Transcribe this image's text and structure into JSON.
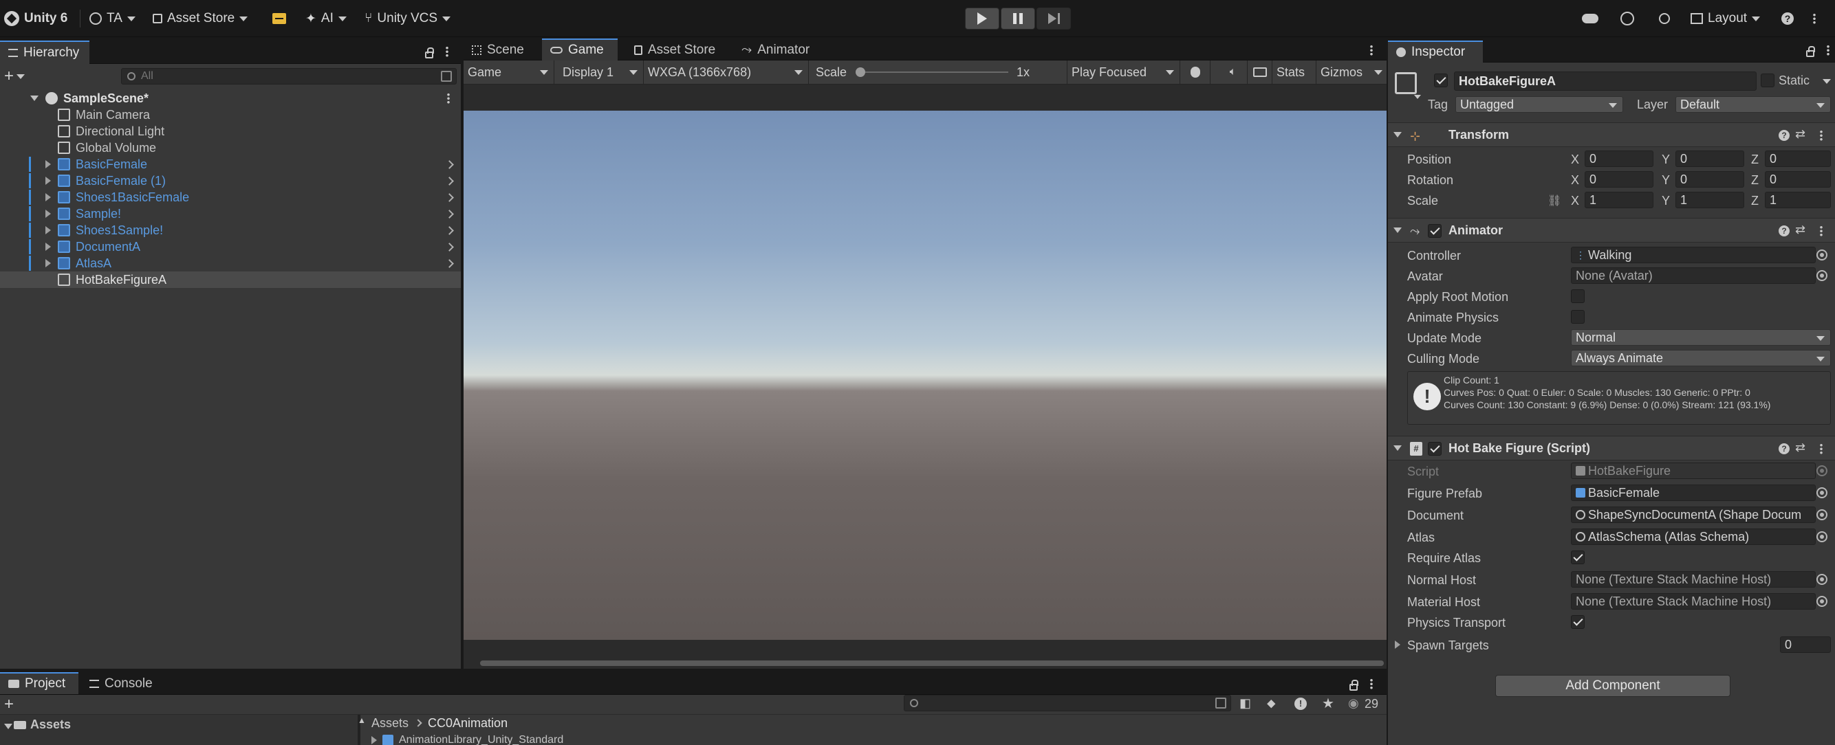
{
  "topbar": {
    "app_name": "Unity 6",
    "account": "TA",
    "asset_store": "Asset Store",
    "ai": "AI",
    "vcs": "Unity VCS",
    "layout": "Layout"
  },
  "hierarchy": {
    "tab": "Hierarchy",
    "search_placeholder": "All",
    "scene": "SampleScene*",
    "items": [
      {
        "label": "Main Camera",
        "prefab": false
      },
      {
        "label": "Directional Light",
        "prefab": false
      },
      {
        "label": "Global Volume",
        "prefab": false
      },
      {
        "label": "BasicFemale",
        "prefab": true
      },
      {
        "label": "BasicFemale (1)",
        "prefab": true
      },
      {
        "label": "Shoes1BasicFemale",
        "prefab": true
      },
      {
        "label": "Sample!",
        "prefab": true
      },
      {
        "label": "Shoes1Sample!",
        "prefab": true
      },
      {
        "label": "DocumentA",
        "prefab": true
      },
      {
        "label": "AtlasA",
        "prefab": true
      },
      {
        "label": "HotBakeFigureA",
        "prefab": false,
        "selected": true
      }
    ]
  },
  "center_tabs": [
    "Scene",
    "Game",
    "Asset Store",
    "Animator"
  ],
  "game_toolbar": {
    "view": "Game",
    "display": "Display 1",
    "resolution": "WXGA (1366x768)",
    "scale_label": "Scale",
    "scale_value": "1x",
    "play_mode": "Play Focused",
    "stats": "Stats",
    "gizmos": "Gizmos"
  },
  "inspector": {
    "tab": "Inspector",
    "object_name": "HotBakeFigureA",
    "static_label": "Static",
    "tag_label": "Tag",
    "tag_value": "Untagged",
    "layer_label": "Layer",
    "layer_value": "Default",
    "transform": {
      "title": "Transform",
      "position_label": "Position",
      "rotation_label": "Rotation",
      "scale_label": "Scale",
      "position": [
        "0",
        "0",
        "0"
      ],
      "rotation": [
        "0",
        "0",
        "0"
      ],
      "scale": [
        "1",
        "1",
        "1"
      ]
    },
    "animator": {
      "title": "Animator",
      "controller_label": "Controller",
      "controller_value": "Walking",
      "avatar_label": "Avatar",
      "avatar_value": "None (Avatar)",
      "root_motion_label": "Apply Root Motion",
      "physics_label": "Animate Physics",
      "update_label": "Update Mode",
      "update_value": "Normal",
      "culling_label": "Culling Mode",
      "culling_value": "Always Animate",
      "info_line1": "Clip Count: 1",
      "info_line2": "Curves Pos: 0 Quat: 0 Euler: 0 Scale: 0 Muscles: 130 Generic: 0 PPtr: 0",
      "info_line3": "Curves Count: 130 Constant: 9 (6.9%) Dense: 0 (0.0%) Stream: 121 (93.1%)"
    },
    "script": {
      "title": "Hot Bake Figure (Script)",
      "script_label": "Script",
      "script_value": "HotBakeFigure",
      "figure_label": "Figure Prefab",
      "figure_value": "BasicFemale",
      "document_label": "Document",
      "document_value": "ShapeSyncDocumentA (Shape Docum",
      "atlas_label": "Atlas",
      "atlas_value": "AtlasSchema (Atlas Schema)",
      "require_atlas_label": "Require Atlas",
      "normal_host_label": "Normal Host",
      "normal_host_value": "None (Texture Stack Machine Host)",
      "material_host_label": "Material Host",
      "material_host_value": "None (Texture Stack Machine Host)",
      "physics_transport_label": "Physics Transport",
      "spawn_targets_label": "Spawn Targets",
      "spawn_targets_value": "0"
    },
    "add_component": "Add Component"
  },
  "project": {
    "tabs": [
      "Project",
      "Console"
    ],
    "breadcrumb_root": "Assets",
    "breadcrumb_current": "CC0Animation",
    "tree_root": "Assets",
    "list_item": "AnimationLibrary_Unity_Standard",
    "count": "29"
  },
  "colors": {
    "accent": "#4a8fe0",
    "prefab_text": "#5a9ae0",
    "panel": "#383838"
  }
}
